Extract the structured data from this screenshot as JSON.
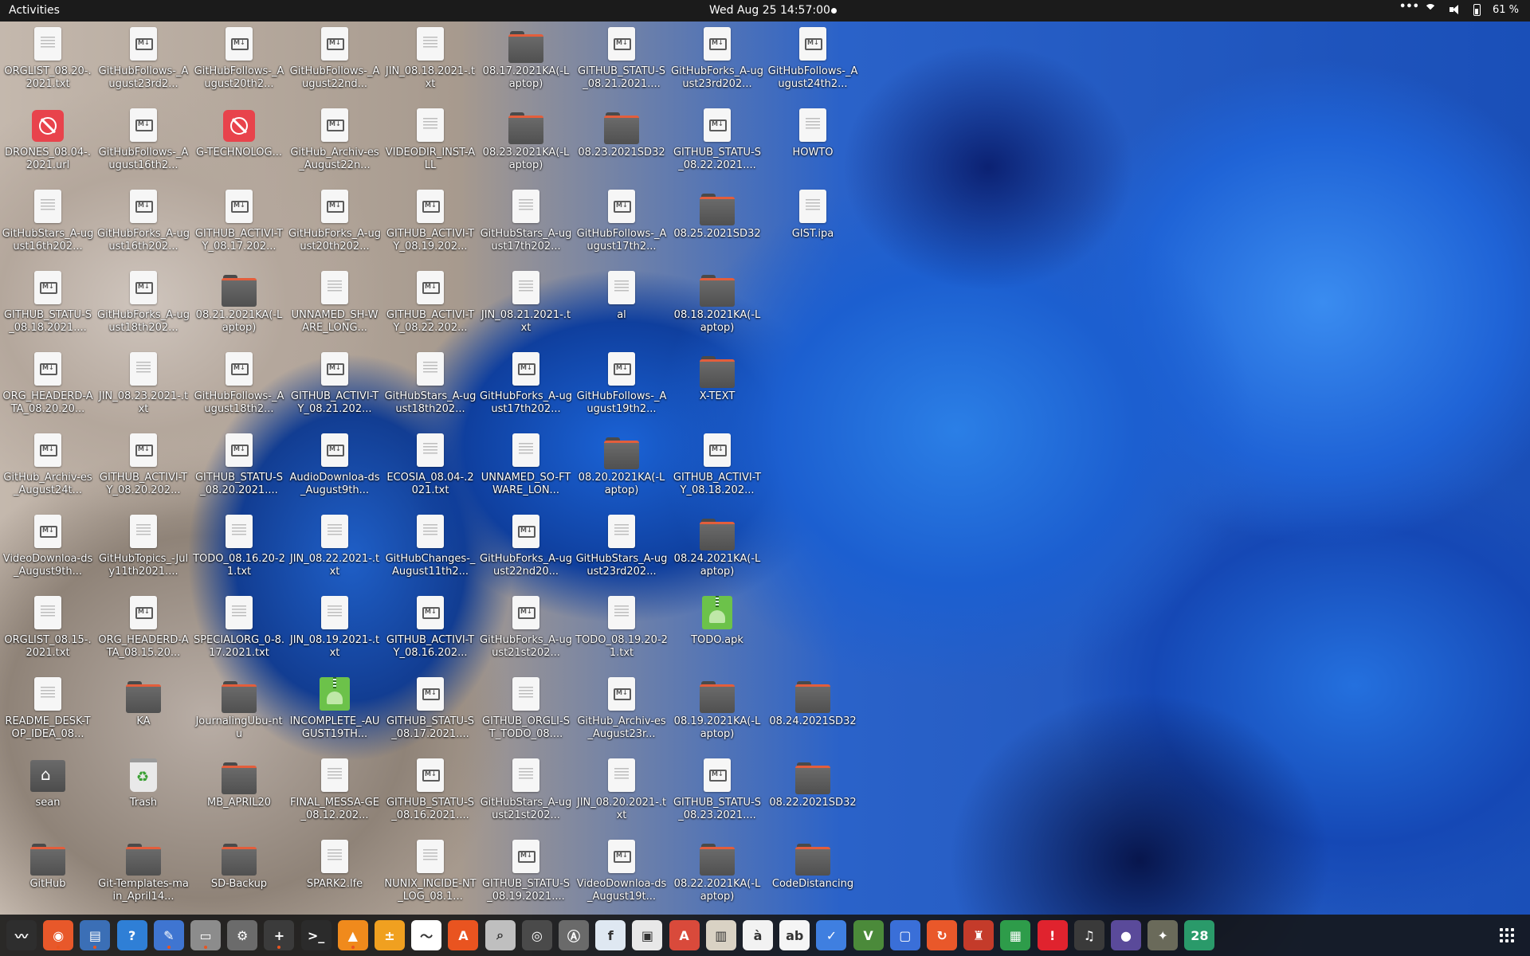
{
  "topbar": {
    "activities": "Activities",
    "clock": "Wed Aug 25  14:57:00",
    "battery": "61 %"
  },
  "desktop_icons": [
    {
      "label": "ORGLIST_08.20-.2021.txt",
      "type": "doc",
      "col": 0,
      "row": 0
    },
    {
      "label": "GitHubFollows-_August23rd2...",
      "type": "md",
      "col": 1,
      "row": 0
    },
    {
      "label": "GitHubFollows-_August20th2...",
      "type": "md",
      "col": 2,
      "row": 0
    },
    {
      "label": "GitHubFollows-_August22nd...",
      "type": "md",
      "col": 3,
      "row": 0
    },
    {
      "label": "JIN_08.18.2021-.txt",
      "type": "doc",
      "col": 4,
      "row": 0
    },
    {
      "label": "08.17.2021KA(-Laptop)",
      "type": "folder",
      "col": 5,
      "row": 0
    },
    {
      "label": "GITHUB_STATU-S_08.21.2021....",
      "type": "md",
      "col": 6,
      "row": 0
    },
    {
      "label": "GitHubForks_A-ugust23rd202...",
      "type": "md",
      "col": 7,
      "row": 0
    },
    {
      "label": "GitHubFollows-_August24th2...",
      "type": "md",
      "col": 8,
      "row": 0
    },
    {
      "label": "DRONES_08.04-.2021.url",
      "type": "blocked",
      "col": 0,
      "row": 1
    },
    {
      "label": "GitHubFollows-_August16th2...",
      "type": "md",
      "col": 1,
      "row": 1
    },
    {
      "label": "G-TECHNOLOG...",
      "type": "blocked",
      "col": 2,
      "row": 1
    },
    {
      "label": "GitHub_Archiv-es_August22n...",
      "type": "md",
      "col": 3,
      "row": 1
    },
    {
      "label": "VIDEODIR_INST-ALL",
      "type": "doc",
      "col": 4,
      "row": 1
    },
    {
      "label": "08.23.2021KA(-Laptop)",
      "type": "folder",
      "col": 5,
      "row": 1
    },
    {
      "label": "08.23.2021SD32",
      "type": "folder",
      "col": 6,
      "row": 1
    },
    {
      "label": "GITHUB_STATU-S_08.22.2021....",
      "type": "md",
      "col": 7,
      "row": 1
    },
    {
      "label": "HOWTO",
      "type": "doc",
      "col": 8,
      "row": 1
    },
    {
      "label": "GitHubStars_A-ugust16th202...",
      "type": "doc",
      "col": 0,
      "row": 2
    },
    {
      "label": "GitHubForks_A-ugust16th202...",
      "type": "md",
      "col": 1,
      "row": 2
    },
    {
      "label": "GITHUB_ACTIVI-TY_08.17.202...",
      "type": "md",
      "col": 2,
      "row": 2
    },
    {
      "label": "GitHubForks_A-ugust20th202...",
      "type": "md",
      "col": 3,
      "row": 2
    },
    {
      "label": "GITHUB_ACTIVI-TY_08.19.202...",
      "type": "md",
      "col": 4,
      "row": 2
    },
    {
      "label": "GitHubStars_A-ugust17th202...",
      "type": "doc",
      "col": 5,
      "row": 2
    },
    {
      "label": "GitHubFollows-_August17th2...",
      "type": "md",
      "col": 6,
      "row": 2
    },
    {
      "label": "08.25.2021SD32",
      "type": "folder",
      "col": 7,
      "row": 2
    },
    {
      "label": "GIST.ipa",
      "type": "doc",
      "col": 8,
      "row": 2
    },
    {
      "label": "GITHUB_STATU-S_08.18.2021....",
      "type": "md",
      "col": 0,
      "row": 3
    },
    {
      "label": "GitHubForks_A-ugust18th202...",
      "type": "md",
      "col": 1,
      "row": 3
    },
    {
      "label": "08.21.2021KA(-Laptop)",
      "type": "folder",
      "col": 2,
      "row": 3
    },
    {
      "label": "UNNAMED_SH-WARE_LONG...",
      "type": "doc",
      "col": 3,
      "row": 3
    },
    {
      "label": "GITHUB_ACTIVI-TY_08.22.202...",
      "type": "md",
      "col": 4,
      "row": 3
    },
    {
      "label": "JIN_08.21.2021-.txt",
      "type": "doc",
      "col": 5,
      "row": 3
    },
    {
      "label": "al",
      "type": "doc",
      "col": 6,
      "row": 3
    },
    {
      "label": "08.18.2021KA(-Laptop)",
      "type": "folder",
      "col": 7,
      "row": 3
    },
    {
      "label": "ORG_HEADERD-ATA_08.20.20...",
      "type": "md",
      "col": 0,
      "row": 4
    },
    {
      "label": "JIN_08.23.2021-.txt",
      "type": "doc",
      "col": 1,
      "row": 4
    },
    {
      "label": "GitHubFollows-_August18th2...",
      "type": "md",
      "col": 2,
      "row": 4
    },
    {
      "label": "GITHUB_ACTIVI-TY_08.21.202...",
      "type": "md",
      "col": 3,
      "row": 4
    },
    {
      "label": "GitHubStars_A-ugust18th202...",
      "type": "doc",
      "col": 4,
      "row": 4
    },
    {
      "label": "GitHubForks_A-ugust17th202...",
      "type": "md",
      "col": 5,
      "row": 4
    },
    {
      "label": "GitHubFollows-_August19th2...",
      "type": "md",
      "col": 6,
      "row": 4
    },
    {
      "label": "X-TEXT",
      "type": "folder",
      "col": 7,
      "row": 4
    },
    {
      "label": "GitHub_Archiv-es_August24t...",
      "type": "md",
      "col": 0,
      "row": 5
    },
    {
      "label": "GITHUB_ACTIVI-TY_08.20.202...",
      "type": "md",
      "col": 1,
      "row": 5
    },
    {
      "label": "GITHUB_STATU-S_08.20.2021....",
      "type": "md",
      "col": 2,
      "row": 5
    },
    {
      "label": "AudioDownloa-ds_August9th...",
      "type": "md",
      "col": 3,
      "row": 5
    },
    {
      "label": "ECOSIA_08.04-.2021.txt",
      "type": "doc",
      "col": 4,
      "row": 5
    },
    {
      "label": "UNNAMED_SO-FTWARE_LON...",
      "type": "doc",
      "col": 5,
      "row": 5
    },
    {
      "label": "08.20.2021KA(-Laptop)",
      "type": "folder",
      "col": 6,
      "row": 5
    },
    {
      "label": "GITHUB_ACTIVI-TY_08.18.202...",
      "type": "md",
      "col": 7,
      "row": 5
    },
    {
      "label": "VideoDownloa-ds_August9th...",
      "type": "md",
      "col": 0,
      "row": 6
    },
    {
      "label": "GitHubTopics_-July11th2021....",
      "type": "doc",
      "col": 1,
      "row": 6
    },
    {
      "label": "TODO_08.16.20-21.txt",
      "type": "doc",
      "col": 2,
      "row": 6
    },
    {
      "label": "JIN_08.22.2021-.txt",
      "type": "doc",
      "col": 3,
      "row": 6
    },
    {
      "label": "GitHubChanges-_August11th2...",
      "type": "doc",
      "col": 4,
      "row": 6
    },
    {
      "label": "GitHubForks_A-ugust22nd20...",
      "type": "md",
      "col": 5,
      "row": 6
    },
    {
      "label": "GitHubStars_A-ugust23rd202...",
      "type": "doc",
      "col": 6,
      "row": 6
    },
    {
      "label": "08.24.2021KA(-Laptop)",
      "type": "folder",
      "col": 7,
      "row": 6
    },
    {
      "label": "ORGLIST_08.15-.2021.txt",
      "type": "doc",
      "col": 0,
      "row": 7
    },
    {
      "label": "ORG_HEADERD-ATA_08.15.20...",
      "type": "md",
      "col": 1,
      "row": 7
    },
    {
      "label": "SPECIALORG_0-8.17.2021.txt",
      "type": "doc",
      "col": 2,
      "row": 7
    },
    {
      "label": "JIN_08.19.2021-.txt",
      "type": "doc",
      "col": 3,
      "row": 7
    },
    {
      "label": "GITHUB_ACTIVI-TY_08.16.202...",
      "type": "md",
      "col": 4,
      "row": 7
    },
    {
      "label": "GitHubForks_A-ugust21st202...",
      "type": "md",
      "col": 5,
      "row": 7
    },
    {
      "label": "TODO_08.19.20-21.txt",
      "type": "doc",
      "col": 6,
      "row": 7
    },
    {
      "label": "TODO.apk",
      "type": "apk",
      "col": 7,
      "row": 7
    },
    {
      "label": "README_DESK-TOP_IDEA_08...",
      "type": "doc",
      "col": 0,
      "row": 8
    },
    {
      "label": "KA",
      "type": "folder",
      "col": 1,
      "row": 8
    },
    {
      "label": "JournalingUbu-ntu",
      "type": "folder",
      "col": 2,
      "row": 8
    },
    {
      "label": "INCOMPLETE_-AUGUST19TH...",
      "type": "apk",
      "col": 3,
      "row": 8
    },
    {
      "label": "GITHUB_STATU-S_08.17.2021....",
      "type": "md",
      "col": 4,
      "row": 8
    },
    {
      "label": "GITHUB_ORGLI-ST_TODO_08....",
      "type": "doc",
      "col": 5,
      "row": 8
    },
    {
      "label": "GitHub_Archiv-es_August23r...",
      "type": "md",
      "col": 6,
      "row": 8
    },
    {
      "label": "08.19.2021KA(-Laptop)",
      "type": "folder",
      "col": 7,
      "row": 8
    },
    {
      "label": "08.24.2021SD32",
      "type": "folder",
      "col": 8,
      "row": 8
    },
    {
      "label": "sean",
      "type": "home",
      "col": 0,
      "row": 9
    },
    {
      "label": "Trash",
      "type": "trash",
      "col": 1,
      "row": 9
    },
    {
      "label": "MB_APRIL20",
      "type": "folder",
      "col": 2,
      "row": 9
    },
    {
      "label": "FINAL_MESSA-GE_08.12.202...",
      "type": "doc",
      "col": 3,
      "row": 9
    },
    {
      "label": "GITHUB_STATU-S_08.16.2021....",
      "type": "md",
      "col": 4,
      "row": 9
    },
    {
      "label": "GitHubStars_A-ugust21st202...",
      "type": "doc",
      "col": 5,
      "row": 9
    },
    {
      "label": "JIN_08.20.2021-.txt",
      "type": "doc",
      "col": 6,
      "row": 9
    },
    {
      "label": "GITHUB_STATU-S_08.23.2021....",
      "type": "md",
      "col": 7,
      "row": 9
    },
    {
      "label": "08.22.2021SD32",
      "type": "folder",
      "col": 8,
      "row": 9
    },
    {
      "label": "GitHub",
      "type": "folder",
      "col": 0,
      "row": 10
    },
    {
      "label": "Git-Templates-main_April14...",
      "type": "folder",
      "col": 1,
      "row": 10
    },
    {
      "label": "SD-Backup",
      "type": "folder",
      "col": 2,
      "row": 10
    },
    {
      "label": "SPARK2.lfe",
      "type": "doc",
      "col": 3,
      "row": 10
    },
    {
      "label": "NUNIX_INCIDE-NT_LOG_08.1...",
      "type": "doc",
      "col": 4,
      "row": 10
    },
    {
      "label": "GITHUB_STATU-S_08.19.2021....",
      "type": "md",
      "col": 5,
      "row": 10
    },
    {
      "label": "VideoDownloa-ds_August19t...",
      "type": "md",
      "col": 6,
      "row": 10
    },
    {
      "label": "08.22.2021KA(-Laptop)",
      "type": "folder",
      "col": 7,
      "row": 10
    },
    {
      "label": "CodeDistancing",
      "type": "folder",
      "col": 8,
      "row": 10
    }
  ],
  "dock": [
    {
      "name": "system-monitor-icon",
      "color": "#2e2e2e",
      "glyph": "〰",
      "running": false
    },
    {
      "name": "firefox-icon",
      "color": "#e8582a",
      "glyph": "◉",
      "running": true
    },
    {
      "name": "document-viewer-icon",
      "color": "#3b6fb6",
      "glyph": "▤",
      "running": true
    },
    {
      "name": "help-icon",
      "color": "#2f7fd6",
      "glyph": "?",
      "running": false
    },
    {
      "name": "text-editor-icon",
      "color": "#3f75d1",
      "glyph": "✎",
      "running": true
    },
    {
      "name": "files-icon",
      "color": "#8c8c8c",
      "glyph": "▭",
      "running": true
    },
    {
      "name": "settings-icon",
      "color": "#6b6b6b",
      "glyph": "⚙",
      "running": false
    },
    {
      "name": "terminal-plus-icon",
      "color": "#3b3b3b",
      "glyph": "+",
      "running": true
    },
    {
      "name": "terminal-icon",
      "color": "#2b2b2b",
      "glyph": ">_",
      "running": false
    },
    {
      "name": "vlc-icon",
      "color": "#f08a1c",
      "glyph": "▲",
      "running": true
    },
    {
      "name": "calculator-icon",
      "color": "#f0a020",
      "glyph": "±",
      "running": false
    },
    {
      "name": "graph-icon",
      "color": "#ffffff",
      "glyph": "〜",
      "running": false
    },
    {
      "name": "software-store-icon",
      "color": "#e95420",
      "glyph": "A",
      "running": false
    },
    {
      "name": "image-viewer-icon",
      "color": "#bfbfbf",
      "glyph": "⌕",
      "running": false
    },
    {
      "name": "disk-usage-icon",
      "color": "#4a4a4a",
      "glyph": "◎",
      "running": false
    },
    {
      "name": "update-manager-icon",
      "color": "#6a6a6a",
      "glyph": "Ⓐ",
      "running": false
    },
    {
      "name": "font-viewer-icon",
      "color": "#dfe8f2",
      "glyph": "f",
      "running": false
    },
    {
      "name": "screenshot-icon",
      "color": "#e8e8e8",
      "glyph": "▣",
      "running": false
    },
    {
      "name": "pdf-icon",
      "color": "#d94a3b",
      "glyph": "A",
      "running": false
    },
    {
      "name": "archive-icon",
      "color": "#d9d2c4",
      "glyph": "▥",
      "running": false
    },
    {
      "name": "character-map-icon",
      "color": "#f2f2f2",
      "glyph": "à",
      "running": false
    },
    {
      "name": "spelling-icon",
      "color": "#f5f5f5",
      "glyph": "ab",
      "running": false
    },
    {
      "name": "todo-icon",
      "color": "#3f7fe0",
      "glyph": "✓",
      "running": false
    },
    {
      "name": "vim-icon",
      "color": "#4b8a3a",
      "glyph": "V",
      "running": false
    },
    {
      "name": "remote-desktop-icon",
      "color": "#3a6fd8",
      "glyph": "▢",
      "running": false
    },
    {
      "name": "backup-icon",
      "color": "#e9582a",
      "glyph": "↻",
      "running": false
    },
    {
      "name": "game-icon",
      "color": "#c43b2a",
      "glyph": "♜",
      "running": false
    },
    {
      "name": "spreadsheet-icon",
      "color": "#2e9c4a",
      "glyph": "▦",
      "running": false
    },
    {
      "name": "alert-icon",
      "color": "#e0232e",
      "glyph": "!",
      "running": false
    },
    {
      "name": "music-icon",
      "color": "#3a3a3a",
      "glyph": "♫",
      "running": false
    },
    {
      "name": "camera-icon",
      "color": "#5a4a9a",
      "glyph": "●",
      "running": false
    },
    {
      "name": "gimp-icon",
      "color": "#6a6a5a",
      "glyph": "✦",
      "running": false
    },
    {
      "name": "calendar-icon",
      "color": "#2a9a6a",
      "glyph": "28",
      "running": false
    }
  ],
  "dock_show_apps": "show-apps-icon"
}
